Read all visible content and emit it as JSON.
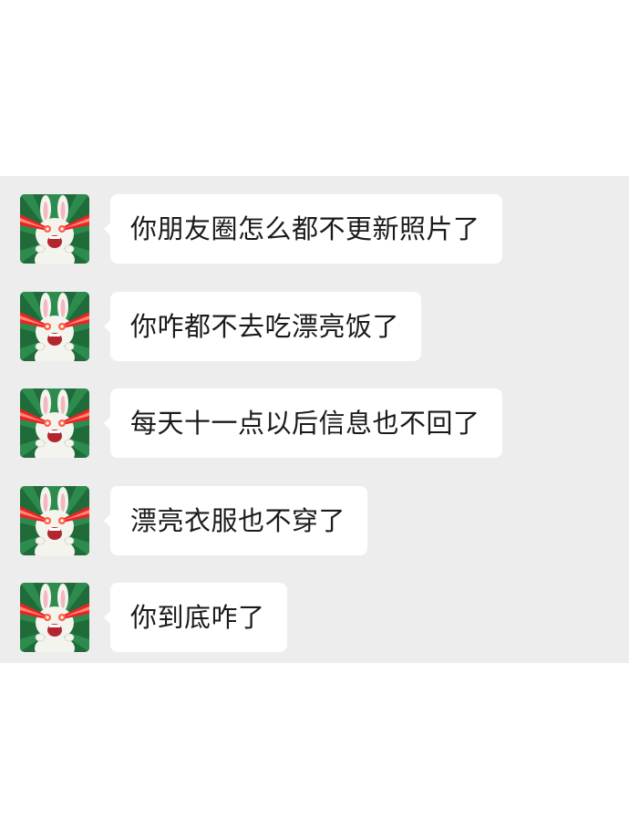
{
  "chat": {
    "sender_avatar": "bunny-laser-eyes-avatar",
    "messages": [
      {
        "text": "你朋友圈怎么都不更新照片了"
      },
      {
        "text": "你咋都不去吃漂亮饭了"
      },
      {
        "text": "每天十一点以后信息也不回了"
      },
      {
        "text": "漂亮衣服也不穿了"
      },
      {
        "text": "你到底咋了"
      }
    ]
  },
  "colors": {
    "chat_background": "#ededed",
    "bubble_background": "#ffffff",
    "text": "#1a1a1a",
    "avatar_green": "#1f6b3a",
    "laser_red": "#e8242c"
  }
}
